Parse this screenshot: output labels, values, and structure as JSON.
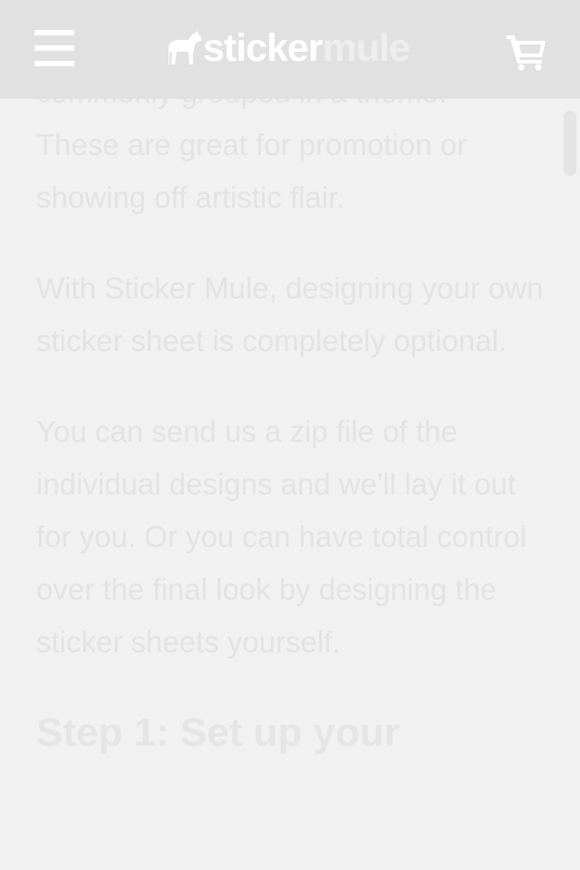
{
  "header": {
    "logo_part1": "sticker",
    "logo_part2": "mule",
    "menu_icon": "hamburger-menu-icon",
    "cart_icon": "shopping-cart-icon",
    "logo_icon": "mule-icon"
  },
  "article": {
    "partial_line": "commonly grouped in a theme.",
    "paragraph1_rest": "These are great for promotion or showing off artistic flair.",
    "paragraph2": "With Sticker Mule, designing your own sticker sheet is completely optional.",
    "paragraph3": "You can send us a zip file of the individual designs and we'll lay it out for you. Or you can have total control over the final look by designing the sticker sheets yourself.",
    "heading": "Step 1: Set up your"
  }
}
